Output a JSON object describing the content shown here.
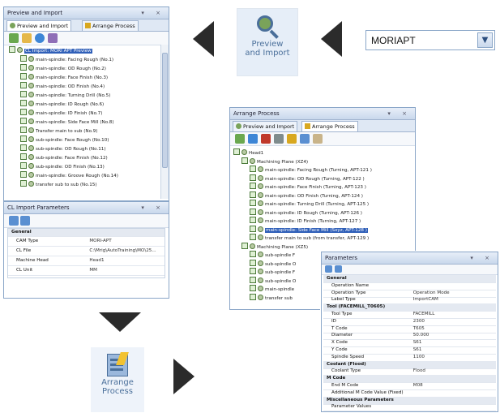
{
  "preview_panel": {
    "title": "Preview and Import",
    "title_buttons": "▾ ×",
    "tabs": [
      "Preview and Import",
      "Arrange Process"
    ],
    "tree": [
      "CL Import: MORI APT Preview",
      "main-spindle: Facing Rough (No.1)",
      "main-spindle: OD Rough (No.2)",
      "main-spindle: Face Finish (No.3)",
      "main-spindle: OD Finish (No.4)",
      "main-spindle: Turning Drill (No.5)",
      "main-spindle: ID Rough (No.6)",
      "main-spindle: ID Finish (No.7)",
      "main-spindle: Side Face Mill (No.8)",
      "Transfer main to sub (No.9)",
      "sub-spindle: Face Rough (No.10)",
      "sub-spindle: OD Rough (No.11)",
      "sub-spindle: Face Finish (No.12)",
      "sub-spindle: OD Finish (No.13)",
      "main-spindle: Groove Rough (No.14)",
      "transfer sub to sub (No.15)"
    ]
  },
  "cl_params": {
    "title": "CL Import Parameters",
    "group": "General",
    "rows": [
      {
        "k": "CAM Type",
        "v": "MORI-APT"
      },
      {
        "k": "CL File",
        "v": "C:\\Mrig\\AutoTraining\\MO\\25..."
      },
      {
        "k": "Machine Head",
        "v": "Head1"
      },
      {
        "k": "CL Unit",
        "v": "MM"
      }
    ]
  },
  "dropdown": {
    "value": "MORIAPT"
  },
  "preview_button": {
    "line1": "Preview",
    "line2": "and Import"
  },
  "arrange_button": {
    "line1": "Arrange",
    "line2": "Process"
  },
  "arrange_panel": {
    "title": "Arrange Process",
    "tabs": [
      "Preview and Import",
      "Arrange Process"
    ],
    "tree": [
      {
        "t": "Head1",
        "lvl": 0
      },
      {
        "t": "Machining Plane (XZ4)",
        "lvl": 1
      },
      {
        "t": "main-spindle: Facing Rough (Turning, APT-121 )",
        "lvl": 2
      },
      {
        "t": "main-spindle: OD Rough (Turning, APT-122 )",
        "lvl": 2
      },
      {
        "t": "main-spindle: Face Finish (Turning, APT-123 )",
        "lvl": 2
      },
      {
        "t": "main-spindle: OD Finish (Turning, APT-124 )",
        "lvl": 2
      },
      {
        "t": "main-spindle: Turning Drill (Turning, APT-125 )",
        "lvl": 2
      },
      {
        "t": "main-spindle: ID Rough (Turning, APT-126 )",
        "lvl": 2
      },
      {
        "t": "main-spindle: ID Finish (Turning, APT-127 )",
        "lvl": 2
      },
      {
        "t": "main-spindle: Side Face Mill (Sxyz, APT-128 )",
        "lvl": 2,
        "sel": true
      },
      {
        "t": "transfer main to sub (from transfer, APT-129 )",
        "lvl": 2
      },
      {
        "t": "Machining Plane (XZ5)",
        "lvl": 1
      },
      {
        "t": "sub-spindle F",
        "lvl": 2
      },
      {
        "t": "sub-spindle O",
        "lvl": 2
      },
      {
        "t": "sub-spindle F",
        "lvl": 2
      },
      {
        "t": "sub-spindle O",
        "lvl": 2
      },
      {
        "t": "main-spindle",
        "lvl": 2
      },
      {
        "t": "transfer sub",
        "lvl": 2
      }
    ]
  },
  "parameters_panel": {
    "title": "Parameters",
    "rows": [
      {
        "k": "General",
        "g": true
      },
      {
        "k": "Operation Name",
        "v": ""
      },
      {
        "k": "Operation Type",
        "v": "Operation Mode"
      },
      {
        "k": "Label Type",
        "v": "ImportCAM"
      },
      {
        "k": "Tool (FACEMILL_T0605)",
        "g": true
      },
      {
        "k": "Tool Type",
        "v": "FACEMILL"
      },
      {
        "k": "ID",
        "v": "2300"
      },
      {
        "k": "T Code",
        "v": "T605"
      },
      {
        "k": "Diameter",
        "v": "50.000"
      },
      {
        "k": "X Code",
        "v": "S61"
      },
      {
        "k": "Y Code",
        "v": "S61"
      },
      {
        "k": "Spindle Speed",
        "v": "1100"
      },
      {
        "k": "Coolant (Flood)",
        "g": true
      },
      {
        "k": "Coolant Type",
        "v": "Flood"
      },
      {
        "k": "M Code",
        "g": true
      },
      {
        "k": "End M Code",
        "v": "M08"
      },
      {
        "k": "Additional M Code Value (Fixed)",
        "v": ""
      },
      {
        "k": "Miscellaneous Parameters",
        "g": true
      },
      {
        "k": "Parameter Values",
        "v": ""
      }
    ]
  },
  "colors": {
    "accent": "#2f5fb8",
    "arrow": "#2b2b2b",
    "panel_border": "#8aa6c8",
    "button_text": "#4a6f9a"
  }
}
